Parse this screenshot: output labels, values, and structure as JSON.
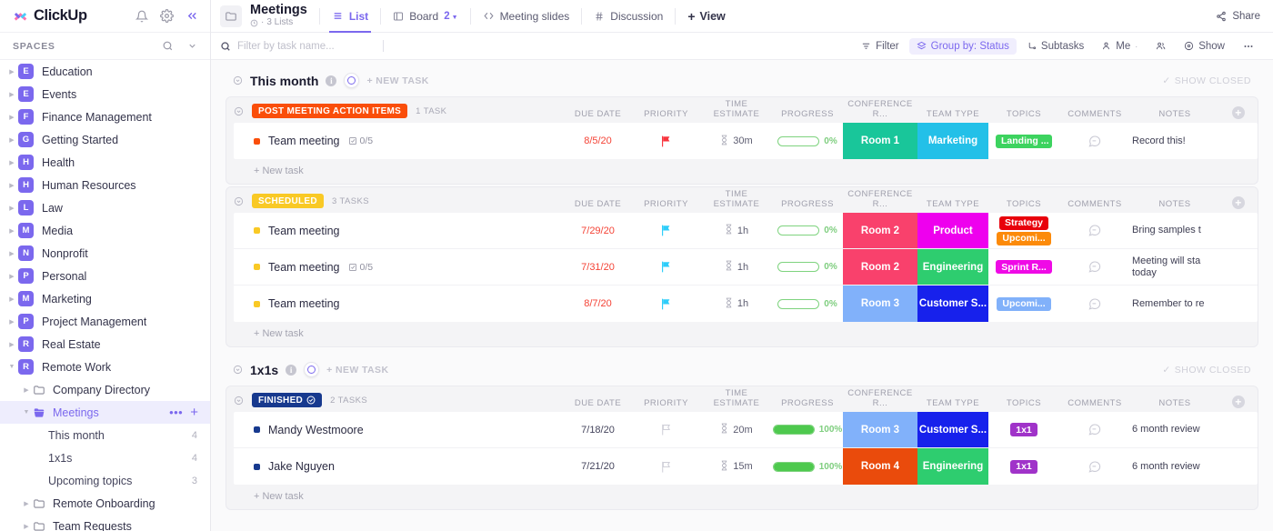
{
  "sidebar": {
    "brand": "ClickUp",
    "icons": [
      "bell-icon",
      "gear-icon",
      "collapse-icon"
    ],
    "spaces_label": "SPACES",
    "spaces": [
      {
        "initial": "E",
        "label": "Education"
      },
      {
        "initial": "E",
        "label": "Events"
      },
      {
        "initial": "F",
        "label": "Finance Management"
      },
      {
        "initial": "G",
        "label": "Getting Started"
      },
      {
        "initial": "H",
        "label": "Health"
      },
      {
        "initial": "H",
        "label": "Human Resources"
      },
      {
        "initial": "L",
        "label": "Law"
      },
      {
        "initial": "M",
        "label": "Media"
      },
      {
        "initial": "N",
        "label": "Nonprofit"
      },
      {
        "initial": "P",
        "label": "Personal"
      },
      {
        "initial": "M",
        "label": "Marketing"
      },
      {
        "initial": "P",
        "label": "Project Management"
      },
      {
        "initial": "R",
        "label": "Real Estate"
      },
      {
        "initial": "R",
        "label": "Remote Work"
      }
    ],
    "folders": [
      {
        "label": "Company Directory",
        "active": false,
        "open": false
      },
      {
        "label": "Meetings",
        "active": true,
        "open": true
      },
      {
        "label": "Remote Onboarding",
        "active": false,
        "open": false
      },
      {
        "label": "Team Requests",
        "active": false,
        "open": false
      }
    ],
    "meeting_lists": [
      {
        "label": "This month",
        "count": "4"
      },
      {
        "label": "1x1s",
        "count": "4"
      },
      {
        "label": "Upcoming topics",
        "count": "3"
      }
    ]
  },
  "header": {
    "title": "Meetings",
    "subtitle": "3 Lists",
    "tabs": [
      {
        "label": "List",
        "icon": "list-icon",
        "active": true,
        "badge": ""
      },
      {
        "label": "Board",
        "icon": "board-icon",
        "active": false,
        "badge": "2"
      },
      {
        "label": "Meeting slides",
        "icon": "code-icon",
        "active": false,
        "badge": ""
      },
      {
        "label": "Discussion",
        "icon": "hash-icon",
        "active": false,
        "badge": ""
      }
    ],
    "add_view": "View",
    "share": "Share"
  },
  "filterbar": {
    "search_placeholder": "Filter by task name...",
    "buttons": [
      {
        "label": "Filter",
        "icon": "filter-icon",
        "highlight": false
      },
      {
        "label": "Group by: Status",
        "icon": "group-icon",
        "highlight": true
      },
      {
        "label": "Subtasks",
        "icon": "subtask-icon",
        "highlight": false
      },
      {
        "label": "Me",
        "icon": "person-icon",
        "highlight": false
      },
      {
        "label": "",
        "icon": "people-icon",
        "highlight": false
      },
      {
        "label": "Show",
        "icon": "eye-icon",
        "highlight": false
      },
      {
        "label": "",
        "icon": "more-icon",
        "highlight": false
      }
    ]
  },
  "columns": [
    "DUE DATE",
    "PRIORITY",
    "TIME ESTIMATE",
    "PROGRESS",
    "CONFERENCE R...",
    "TEAM TYPE",
    "TOPICS",
    "COMMENTS",
    "NOTES"
  ],
  "labels": {
    "new_task_caps": "+ NEW TASK",
    "new_task": "+ New task",
    "show_closed": "SHOW CLOSED"
  },
  "sections": [
    {
      "title": "This month",
      "groups": [
        {
          "status": "POST MEETING ACTION ITEMS",
          "status_color": "#fa4e0a",
          "count": "1 TASK",
          "has_check": false,
          "tasks": [
            {
              "dot_color": "#fa4e0a",
              "name": "Team meeting",
              "subtask": "0/5",
              "due": "8/5/20",
              "due_overdue": true,
              "priority_color": "#f8353e",
              "estimate": "30m",
              "progress": 0,
              "progress_label": "0%",
              "room": "Room 1",
              "room_color": "#19c69a",
              "team": "Marketing",
              "team_color": "#23c0e8",
              "topics": [
                {
                  "label": "Landing ...",
                  "color": "#3dd35f"
                }
              ],
              "notes": "Record this!"
            }
          ]
        },
        {
          "status": "SCHEDULED",
          "status_color": "#f9c925",
          "count": "3 TASKS",
          "has_check": false,
          "tasks": [
            {
              "dot_color": "#f9c925",
              "name": "Team meeting",
              "subtask": "",
              "due": "7/29/20",
              "due_overdue": true,
              "priority_color": "#2ecdfa",
              "estimate": "1h",
              "progress": 0,
              "progress_label": "0%",
              "room": "Room 2",
              "room_color": "#f9416c",
              "team": "Product",
              "team_color": "#ee00ee",
              "topics": [
                {
                  "label": "Strategy",
                  "color": "#e8000b"
                },
                {
                  "label": "Upcomi...",
                  "color": "#fc8a0a"
                }
              ],
              "notes": "Bring samples t"
            },
            {
              "dot_color": "#f9c925",
              "name": "Team meeting",
              "subtask": "0/5",
              "due": "7/31/20",
              "due_overdue": true,
              "priority_color": "#2ecdfa",
              "estimate": "1h",
              "progress": 0,
              "progress_label": "0%",
              "room": "Room 2",
              "room_color": "#f9416c",
              "team": "Engineering",
              "team_color": "#2ecd6f",
              "topics": [
                {
                  "label": "Sprint R...",
                  "color": "#ef0ae6"
                }
              ],
              "notes": "Meeting will sta today"
            },
            {
              "dot_color": "#f9c925",
              "name": "Team meeting",
              "subtask": "",
              "due": "8/7/20",
              "due_overdue": true,
              "priority_color": "#2ecdfa",
              "estimate": "1h",
              "progress": 0,
              "progress_label": "0%",
              "room": "Room 3",
              "room_color": "#81b1fa",
              "team": "Customer S...",
              "team_color": "#1721ec",
              "topics": [
                {
                  "label": "Upcomi...",
                  "color": "#81b1fa"
                }
              ],
              "notes": "Remember to re"
            }
          ]
        }
      ]
    },
    {
      "title": "1x1s",
      "groups": [
        {
          "status": "FINISHED",
          "status_color": "#17398e",
          "count": "2 TASKS",
          "has_check": true,
          "tasks": [
            {
              "dot_color": "#17398e",
              "name": "Mandy Westmoore",
              "subtask": "",
              "due": "7/18/20",
              "due_overdue": false,
              "priority_color": "#cfcfd8",
              "estimate": "20m",
              "progress": 100,
              "progress_label": "100%",
              "room": "Room 3",
              "room_color": "#81b1fa",
              "team": "Customer S...",
              "team_color": "#1721ec",
              "topics": [
                {
                  "label": "1x1",
                  "color": "#a033c9"
                }
              ],
              "notes": "6 month review"
            },
            {
              "dot_color": "#17398e",
              "name": "Jake Nguyen",
              "subtask": "",
              "due": "7/21/20",
              "due_overdue": false,
              "priority_color": "#cfcfd8",
              "estimate": "15m",
              "progress": 100,
              "progress_label": "100%",
              "room": "Room 4",
              "room_color": "#ea4b0c",
              "team": "Engineering",
              "team_color": "#2ecd6f",
              "topics": [
                {
                  "label": "1x1",
                  "color": "#a033c9"
                }
              ],
              "notes": "6 month review"
            }
          ]
        }
      ]
    }
  ],
  "colors": {
    "accent": "#7b68ee",
    "overdue": "#f44336",
    "progress": "#4ec94e"
  }
}
